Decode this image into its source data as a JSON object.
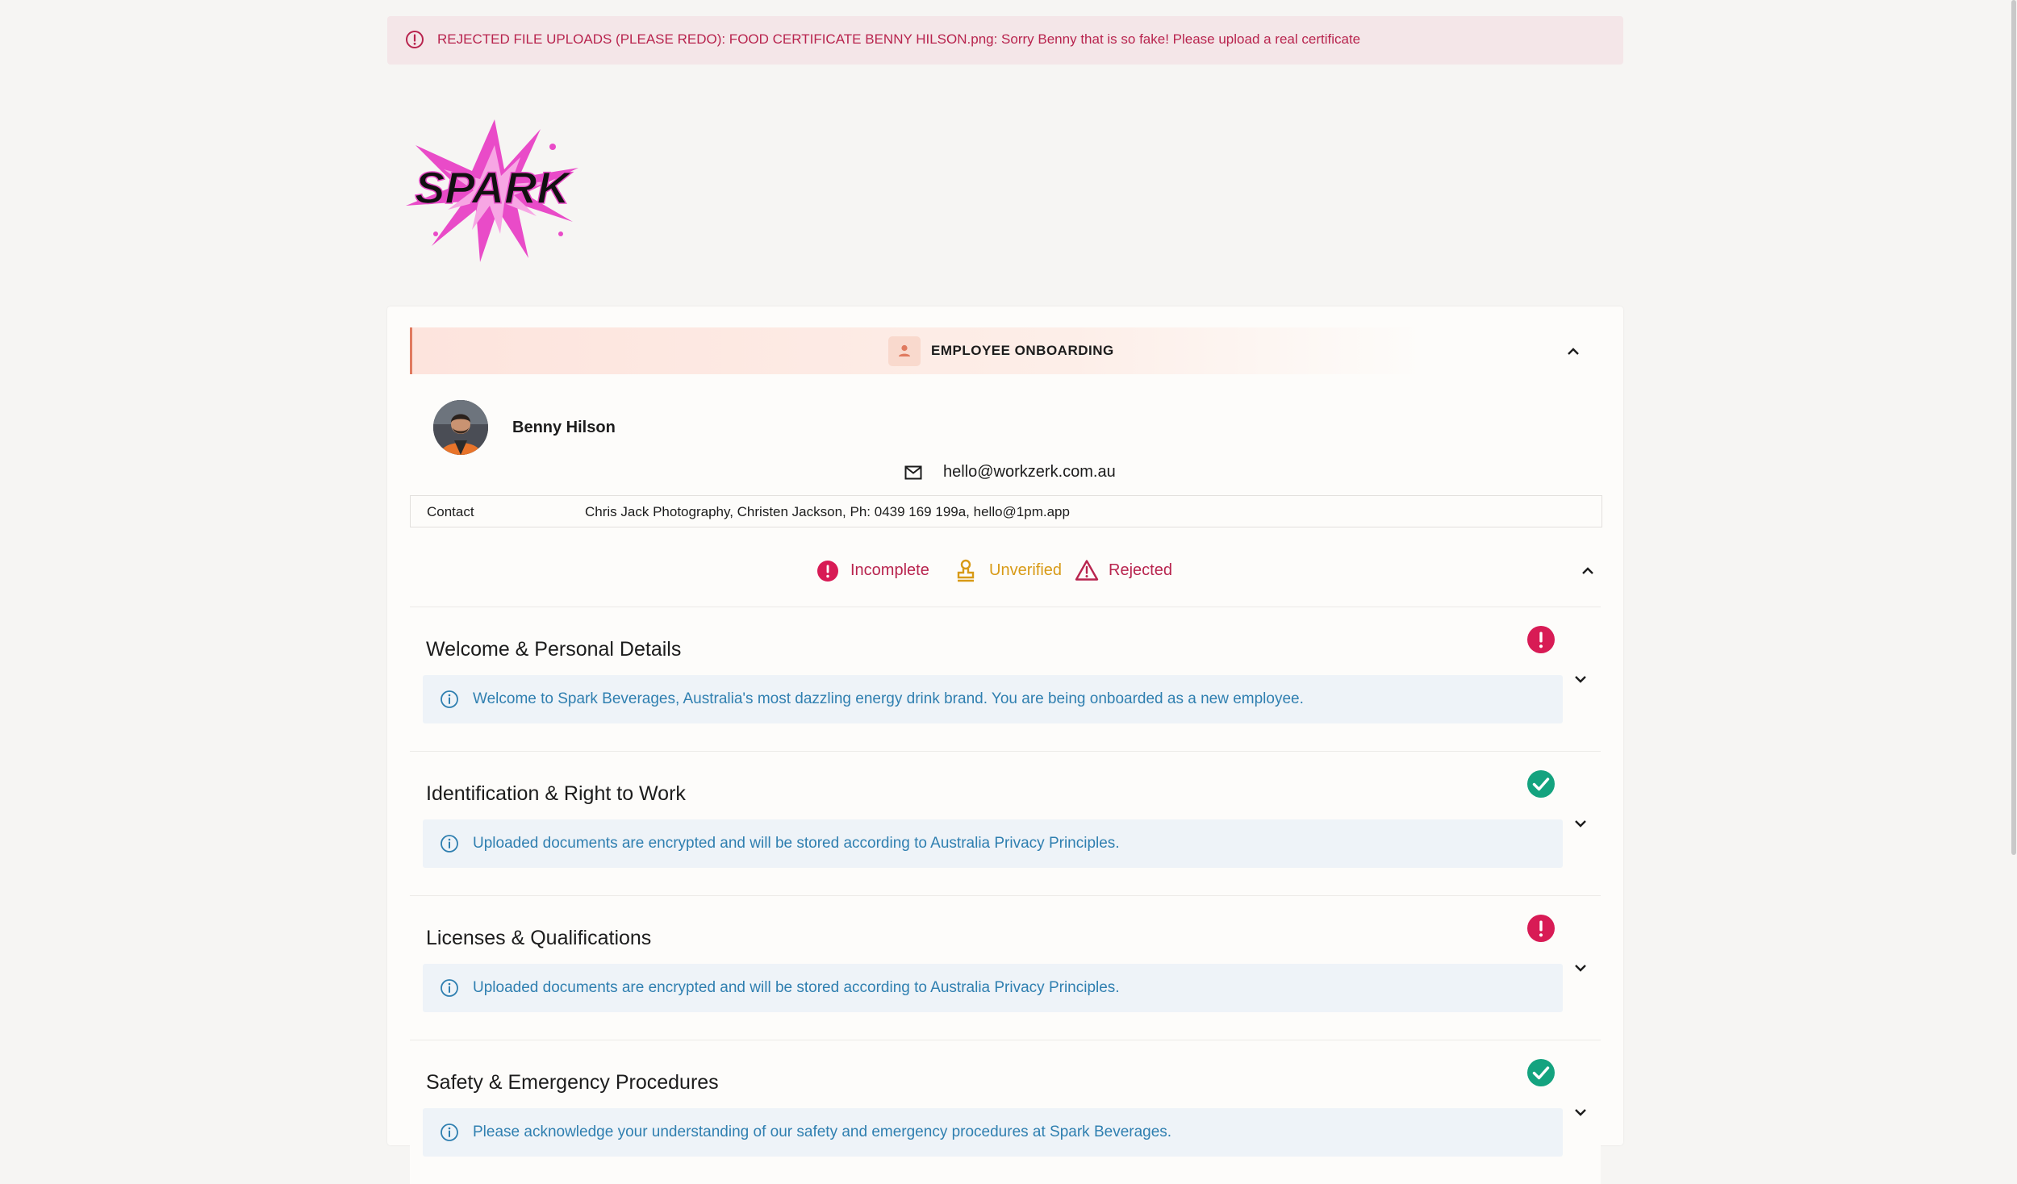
{
  "banner": {
    "text": "REJECTED FILE UPLOADS (PLEASE REDO): FOOD CERTIFICATE BENNY HILSON.png: Sorry Benny that is so fake! Please upload a real certificate"
  },
  "logo": {
    "text": "SPARK"
  },
  "onboarding": {
    "title": "EMPLOYEE ONBOARDING"
  },
  "employee": {
    "name": "Benny Hilson",
    "email": "hello@workzerk.com.au",
    "contact_label": "Contact",
    "contact_value": "Chris Jack Photography, Christen Jackson, Ph: 0439 169 199a, hello@1pm.app"
  },
  "legend": {
    "incomplete": "Incomplete",
    "unverified": "Unverified",
    "rejected": "Rejected"
  },
  "sections": [
    {
      "title": "Welcome & Personal Details",
      "status": "incomplete",
      "info": "Welcome to Spark Beverages, Australia's most dazzling energy drink brand. You are being onboarded as a new employee."
    },
    {
      "title": "Identification & Right to Work",
      "status": "complete",
      "info": "Uploaded documents are encrypted and will be stored according to Australia Privacy Principles."
    },
    {
      "title": "Licenses & Qualifications",
      "status": "incomplete",
      "info": "Uploaded documents are encrypted and will be stored according to Australia Privacy Principles."
    },
    {
      "title": "Safety & Emergency Procedures",
      "status": "complete",
      "info": "Please acknowledge your understanding of our safety and emergency procedures at Spark Beverages."
    }
  ],
  "colors": {
    "error": "#b8244e",
    "status_incomplete": "#d81b55",
    "status_complete": "#14a37f",
    "unverified": "#d89a16",
    "info_text": "#2f7fb0",
    "brand_pink": "#e94bc8"
  }
}
